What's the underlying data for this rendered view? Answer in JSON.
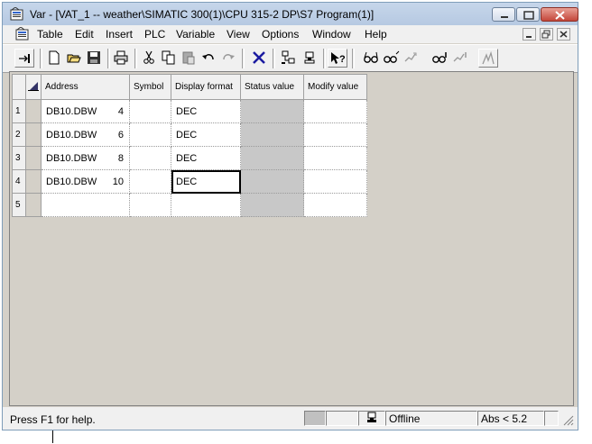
{
  "window": {
    "title": "Var - [VAT_1 -- weather\\SIMATIC 300(1)\\CPU 315-2 DP\\S7 Program(1)]"
  },
  "menubar": {
    "items": [
      "Table",
      "Edit",
      "Insert",
      "PLC",
      "Variable",
      "View",
      "Options",
      "Window",
      "Help"
    ]
  },
  "table": {
    "headers": {
      "address": "Address",
      "symbol": "Symbol",
      "display_format": "Display format",
      "status_value": "Status value",
      "modify_value": "Modify value"
    },
    "rows": [
      {
        "num": "1",
        "area": "DB10.DBW",
        "offset": "4",
        "symbol": "",
        "format": "DEC",
        "status": "",
        "modify": ""
      },
      {
        "num": "2",
        "area": "DB10.DBW",
        "offset": "6",
        "symbol": "",
        "format": "DEC",
        "status": "",
        "modify": ""
      },
      {
        "num": "3",
        "area": "DB10.DBW",
        "offset": "8",
        "symbol": "",
        "format": "DEC",
        "status": "",
        "modify": ""
      },
      {
        "num": "4",
        "area": "DB10.DBW",
        "offset": "10",
        "symbol": "",
        "format": "DEC",
        "status": "",
        "modify": ""
      },
      {
        "num": "5",
        "area": "",
        "offset": "",
        "symbol": "",
        "format": "",
        "status": "",
        "modify": ""
      }
    ]
  },
  "statusbar": {
    "help": "Press F1 for help.",
    "connection": "Offline",
    "abs": "Abs < 5.2"
  },
  "colors": {
    "status_column": "#c8c8c8",
    "chrome": "#f0f0f0"
  }
}
